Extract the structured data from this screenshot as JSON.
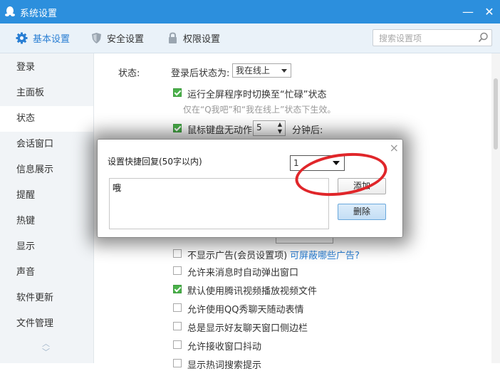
{
  "window": {
    "title": "系统设置"
  },
  "tabs": [
    {
      "label": "基本设置",
      "icon": "gear-icon"
    },
    {
      "label": "安全设置",
      "icon": "shield-icon"
    },
    {
      "label": "权限设置",
      "icon": "lock-icon"
    }
  ],
  "search": {
    "placeholder": "搜索设置项"
  },
  "sidebar": {
    "items": [
      "登录",
      "主面板",
      "状态",
      "会话窗口",
      "信息展示",
      "提醒",
      "热键",
      "显示",
      "声音",
      "软件更新",
      "文件管理"
    ],
    "active": "状态"
  },
  "status": {
    "section_label": "状态:",
    "login_status_label": "登录后状态为:",
    "login_status_value": "我在线上",
    "fullscreen_busy": {
      "label": "运行全屏程序时切换至“忙碌”状态",
      "checked": true
    },
    "fullscreen_hint": "仅在“Q我吧”和“我在线上”状态下生效。",
    "idle_option": {
      "label": "鼠标键盘无动作",
      "checked": true,
      "minutes": "5",
      "suffix": "分钟后:"
    }
  },
  "options": [
    {
      "label": "不显示广告(会员设置项)",
      "checked": false,
      "link": "可屏蔽哪些广告?"
    },
    {
      "label": "允许来消息时自动弹出窗口",
      "checked": false
    },
    {
      "label": "默认使用腾讯视频播放视频文件",
      "checked": true
    },
    {
      "label": "允许使用QQ秀聊天随动表情",
      "checked": false
    },
    {
      "label": "总是显示好友聊天窗口侧边栏",
      "checked": false
    },
    {
      "label": "允许接收窗口抖动",
      "checked": false
    },
    {
      "label": "显示热词搜索提示",
      "checked": false
    }
  ],
  "dialog": {
    "title": "设置快捷回复(50字以内)",
    "select_value": "1",
    "text": "哦",
    "add_label": "添加",
    "delete_label": "删除",
    "close_glyph": "×"
  },
  "window_controls": {
    "minimize": "—",
    "close": "✕"
  },
  "colors": {
    "titlebar": "#2c8fdd",
    "accent_link": "#2a7fd4",
    "check_on": "#4ab24a",
    "annotation": "#e0262a"
  }
}
